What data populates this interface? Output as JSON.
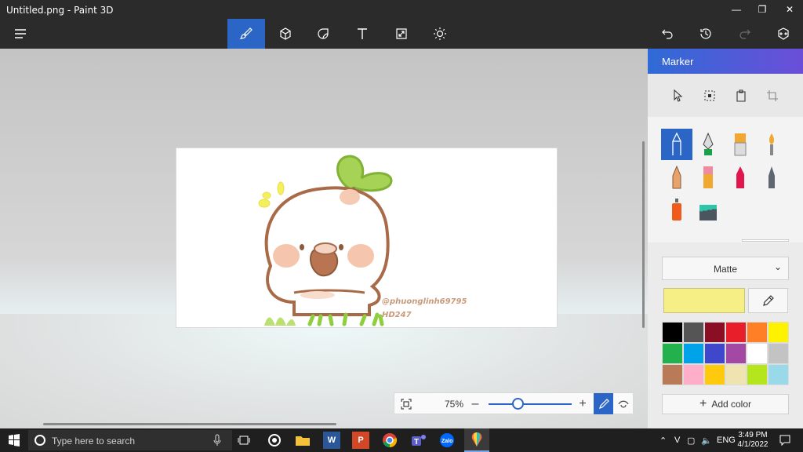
{
  "window": {
    "title": "Untitled.png - Paint 3D"
  },
  "toolbar": {
    "tools": [
      "brushes",
      "3d-shapes",
      "stickers",
      "text",
      "effects",
      "canvas"
    ]
  },
  "canvas": {
    "artwork": {
      "watermark_handle": "@phuonglinh69795",
      "watermark_code": "HD247"
    }
  },
  "zoom": {
    "percent": "75%",
    "level": 0.35
  },
  "panel": {
    "title": "Marker",
    "finish": "Matte",
    "selected_color": "#f6ef86",
    "add_color_label": "Add color",
    "swatches": [
      "#000000",
      "#555555",
      "#8a0f24",
      "#e81f2a",
      "#ff7f27",
      "#fff200",
      "#22b14c",
      "#00a2e8",
      "#3f48cc",
      "#a349a4",
      "#ffffff",
      "#c3c3c3",
      "#b97a57",
      "#ffaec9",
      "#ffc90e",
      "#efe4b0",
      "#b5e61d",
      "#99d9ea"
    ]
  },
  "taskbar": {
    "search_placeholder": "Type here to search",
    "language": "ENG",
    "time": "3:49 PM",
    "date": "4/1/2022"
  }
}
